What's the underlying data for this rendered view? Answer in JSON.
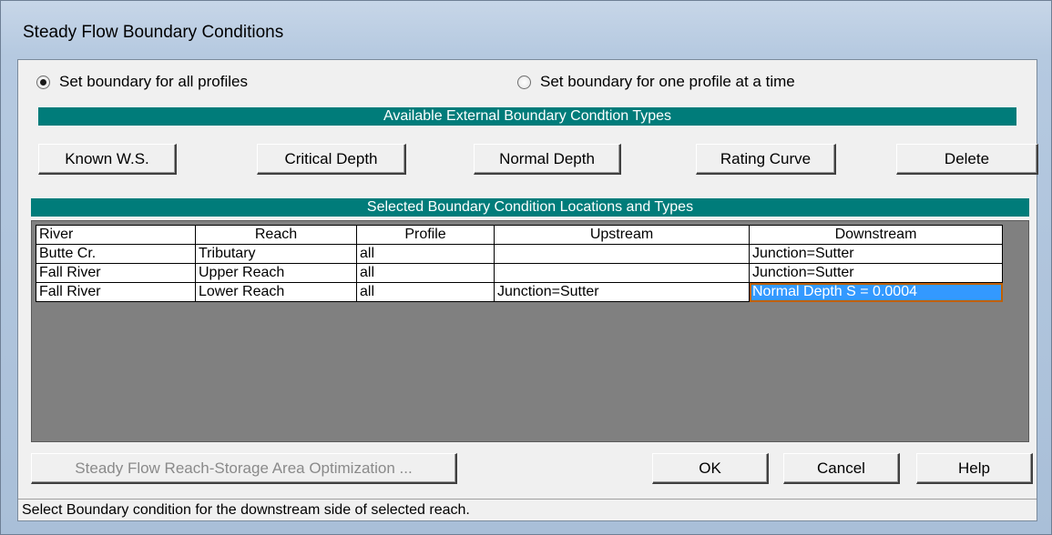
{
  "window": {
    "title": "Steady Flow Boundary Conditions"
  },
  "options": {
    "all_profiles": "Set boundary for all profiles",
    "one_profile": "Set boundary for one profile at a time"
  },
  "types_bar": "Available External Boundary Condtion Types",
  "type_buttons": {
    "known_ws": "Known W.S.",
    "critical_depth": "Critical Depth",
    "normal_depth": "Normal Depth",
    "rating_curve": "Rating Curve",
    "delete": "Delete"
  },
  "locations_bar": "Selected Boundary Condition Locations and Types",
  "table": {
    "headers": {
      "river": "River",
      "reach": "Reach",
      "profile": "Profile",
      "upstream": "Upstream",
      "downstream": "Downstream"
    },
    "rows": [
      {
        "river": "Butte Cr.",
        "reach": "Tributary",
        "profile": "all",
        "upstream": "",
        "downstream": "Junction=Sutter"
      },
      {
        "river": "Fall River",
        "reach": "Upper Reach",
        "profile": "all",
        "upstream": "",
        "downstream": "Junction=Sutter"
      },
      {
        "river": "Fall River",
        "reach": "Lower Reach",
        "profile": "all",
        "upstream": "Junction=Sutter",
        "downstream": "Normal Depth S = 0.0004"
      }
    ]
  },
  "bottom_buttons": {
    "optimization": "Steady Flow Reach-Storage Area Optimization ...",
    "ok": "OK",
    "cancel": "Cancel",
    "help": "Help"
  },
  "status": "Select Boundary condition for the downstream side of selected reach.",
  "colors": {
    "bar": "#007c7a",
    "selection": "#3399ff"
  }
}
